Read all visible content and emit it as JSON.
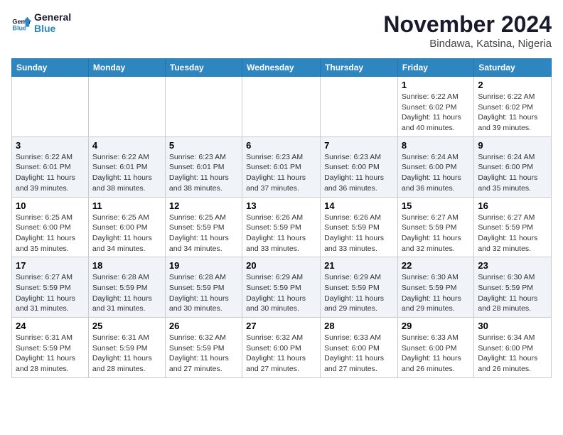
{
  "logo": {
    "line1": "General",
    "line2": "Blue"
  },
  "title": "November 2024",
  "location": "Bindawa, Katsina, Nigeria",
  "days_of_week": [
    "Sunday",
    "Monday",
    "Tuesday",
    "Wednesday",
    "Thursday",
    "Friday",
    "Saturday"
  ],
  "weeks": [
    [
      {
        "day": "",
        "text": ""
      },
      {
        "day": "",
        "text": ""
      },
      {
        "day": "",
        "text": ""
      },
      {
        "day": "",
        "text": ""
      },
      {
        "day": "",
        "text": ""
      },
      {
        "day": "1",
        "text": "Sunrise: 6:22 AM\nSunset: 6:02 PM\nDaylight: 11 hours and 40 minutes."
      },
      {
        "day": "2",
        "text": "Sunrise: 6:22 AM\nSunset: 6:02 PM\nDaylight: 11 hours and 39 minutes."
      }
    ],
    [
      {
        "day": "3",
        "text": "Sunrise: 6:22 AM\nSunset: 6:01 PM\nDaylight: 11 hours and 39 minutes."
      },
      {
        "day": "4",
        "text": "Sunrise: 6:22 AM\nSunset: 6:01 PM\nDaylight: 11 hours and 38 minutes."
      },
      {
        "day": "5",
        "text": "Sunrise: 6:23 AM\nSunset: 6:01 PM\nDaylight: 11 hours and 38 minutes."
      },
      {
        "day": "6",
        "text": "Sunrise: 6:23 AM\nSunset: 6:01 PM\nDaylight: 11 hours and 37 minutes."
      },
      {
        "day": "7",
        "text": "Sunrise: 6:23 AM\nSunset: 6:00 PM\nDaylight: 11 hours and 36 minutes."
      },
      {
        "day": "8",
        "text": "Sunrise: 6:24 AM\nSunset: 6:00 PM\nDaylight: 11 hours and 36 minutes."
      },
      {
        "day": "9",
        "text": "Sunrise: 6:24 AM\nSunset: 6:00 PM\nDaylight: 11 hours and 35 minutes."
      }
    ],
    [
      {
        "day": "10",
        "text": "Sunrise: 6:25 AM\nSunset: 6:00 PM\nDaylight: 11 hours and 35 minutes."
      },
      {
        "day": "11",
        "text": "Sunrise: 6:25 AM\nSunset: 6:00 PM\nDaylight: 11 hours and 34 minutes."
      },
      {
        "day": "12",
        "text": "Sunrise: 6:25 AM\nSunset: 5:59 PM\nDaylight: 11 hours and 34 minutes."
      },
      {
        "day": "13",
        "text": "Sunrise: 6:26 AM\nSunset: 5:59 PM\nDaylight: 11 hours and 33 minutes."
      },
      {
        "day": "14",
        "text": "Sunrise: 6:26 AM\nSunset: 5:59 PM\nDaylight: 11 hours and 33 minutes."
      },
      {
        "day": "15",
        "text": "Sunrise: 6:27 AM\nSunset: 5:59 PM\nDaylight: 11 hours and 32 minutes."
      },
      {
        "day": "16",
        "text": "Sunrise: 6:27 AM\nSunset: 5:59 PM\nDaylight: 11 hours and 32 minutes."
      }
    ],
    [
      {
        "day": "17",
        "text": "Sunrise: 6:27 AM\nSunset: 5:59 PM\nDaylight: 11 hours and 31 minutes."
      },
      {
        "day": "18",
        "text": "Sunrise: 6:28 AM\nSunset: 5:59 PM\nDaylight: 11 hours and 31 minutes."
      },
      {
        "day": "19",
        "text": "Sunrise: 6:28 AM\nSunset: 5:59 PM\nDaylight: 11 hours and 30 minutes."
      },
      {
        "day": "20",
        "text": "Sunrise: 6:29 AM\nSunset: 5:59 PM\nDaylight: 11 hours and 30 minutes."
      },
      {
        "day": "21",
        "text": "Sunrise: 6:29 AM\nSunset: 5:59 PM\nDaylight: 11 hours and 29 minutes."
      },
      {
        "day": "22",
        "text": "Sunrise: 6:30 AM\nSunset: 5:59 PM\nDaylight: 11 hours and 29 minutes."
      },
      {
        "day": "23",
        "text": "Sunrise: 6:30 AM\nSunset: 5:59 PM\nDaylight: 11 hours and 28 minutes."
      }
    ],
    [
      {
        "day": "24",
        "text": "Sunrise: 6:31 AM\nSunset: 5:59 PM\nDaylight: 11 hours and 28 minutes."
      },
      {
        "day": "25",
        "text": "Sunrise: 6:31 AM\nSunset: 5:59 PM\nDaylight: 11 hours and 28 minutes."
      },
      {
        "day": "26",
        "text": "Sunrise: 6:32 AM\nSunset: 5:59 PM\nDaylight: 11 hours and 27 minutes."
      },
      {
        "day": "27",
        "text": "Sunrise: 6:32 AM\nSunset: 6:00 PM\nDaylight: 11 hours and 27 minutes."
      },
      {
        "day": "28",
        "text": "Sunrise: 6:33 AM\nSunset: 6:00 PM\nDaylight: 11 hours and 27 minutes."
      },
      {
        "day": "29",
        "text": "Sunrise: 6:33 AM\nSunset: 6:00 PM\nDaylight: 11 hours and 26 minutes."
      },
      {
        "day": "30",
        "text": "Sunrise: 6:34 AM\nSunset: 6:00 PM\nDaylight: 11 hours and 26 minutes."
      }
    ]
  ]
}
